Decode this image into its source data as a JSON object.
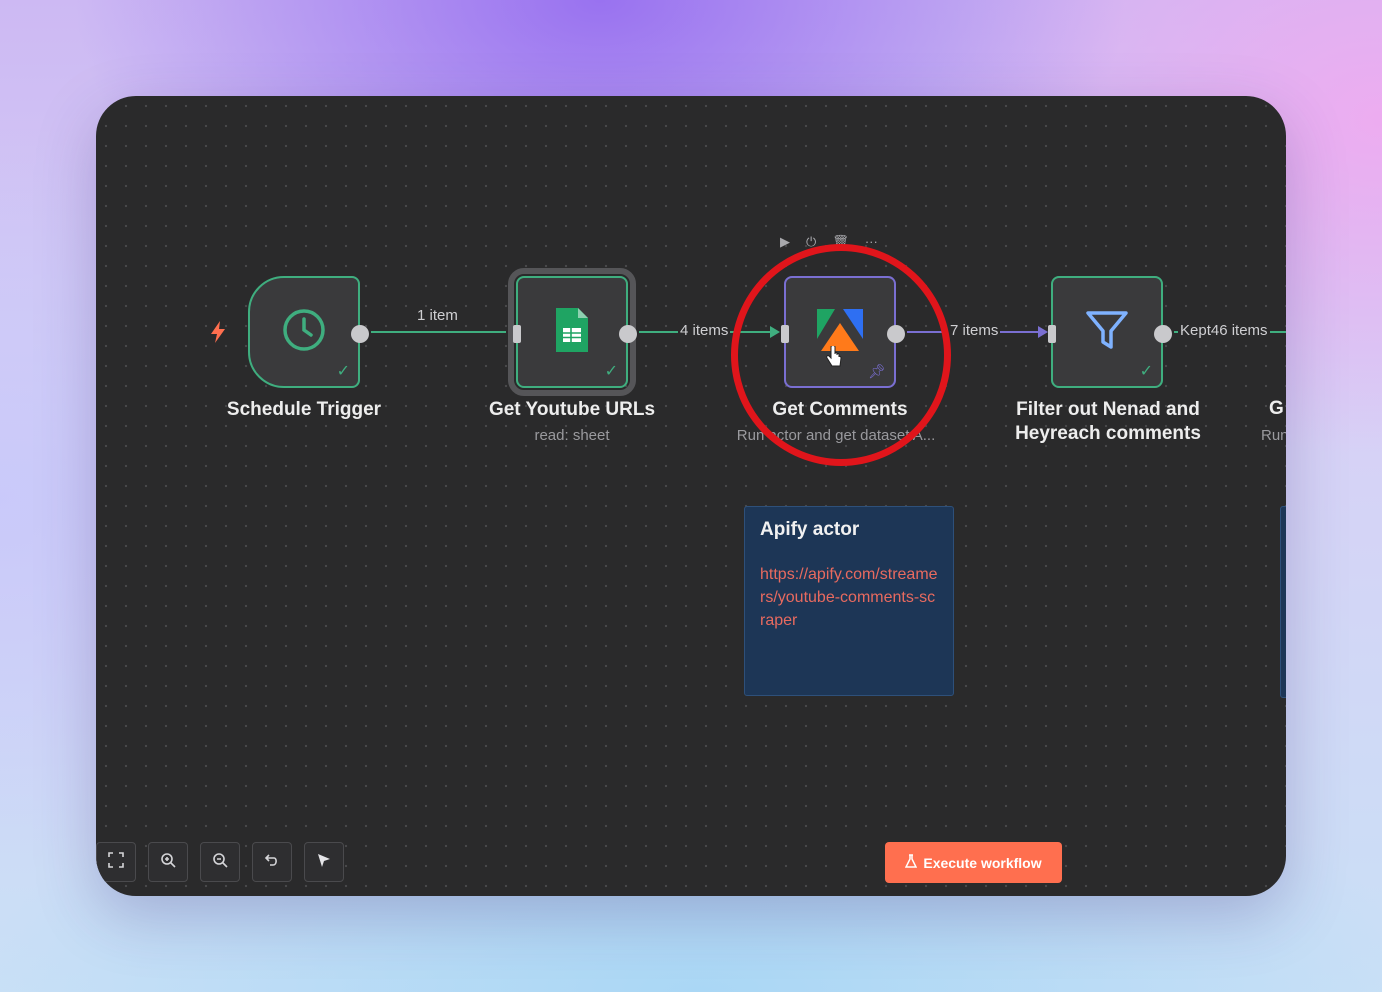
{
  "canvas": {
    "nodes": [
      {
        "id": "schedule",
        "title": "Schedule Trigger",
        "subtitle": ""
      },
      {
        "id": "sheets",
        "title": "Get Youtube URLs",
        "subtitle": "read: sheet"
      },
      {
        "id": "apify",
        "title": "Get Comments",
        "subtitle": "Run actor and get dataset A..."
      },
      {
        "id": "filter",
        "title": "Filter out Nenad and Heyreach comments",
        "subtitle": ""
      },
      {
        "id": "partial",
        "title": "G",
        "subtitle": "Run"
      }
    ],
    "edges": [
      {
        "label": "1 item"
      },
      {
        "label": "4 items"
      },
      {
        "label": "7 items"
      },
      {
        "label": "Kept46 items"
      }
    ],
    "hover_toolbar": [
      "play-icon",
      "power-icon",
      "trash-icon",
      "more-icon"
    ]
  },
  "sticky_note": {
    "title": "Apify actor",
    "link": "https://apify.com/streamers/youtube-comments-scraper"
  },
  "toolbar": {
    "buttons": [
      "fit-view",
      "zoom-in",
      "zoom-out",
      "undo",
      "select"
    ],
    "execute_label": "Execute workflow"
  },
  "colors": {
    "success": "#3fae7f",
    "pinned": "#7a6fd2",
    "accent": "#ff6f4f",
    "annotation": "#e0151b",
    "note_bg": "#1d3656"
  }
}
